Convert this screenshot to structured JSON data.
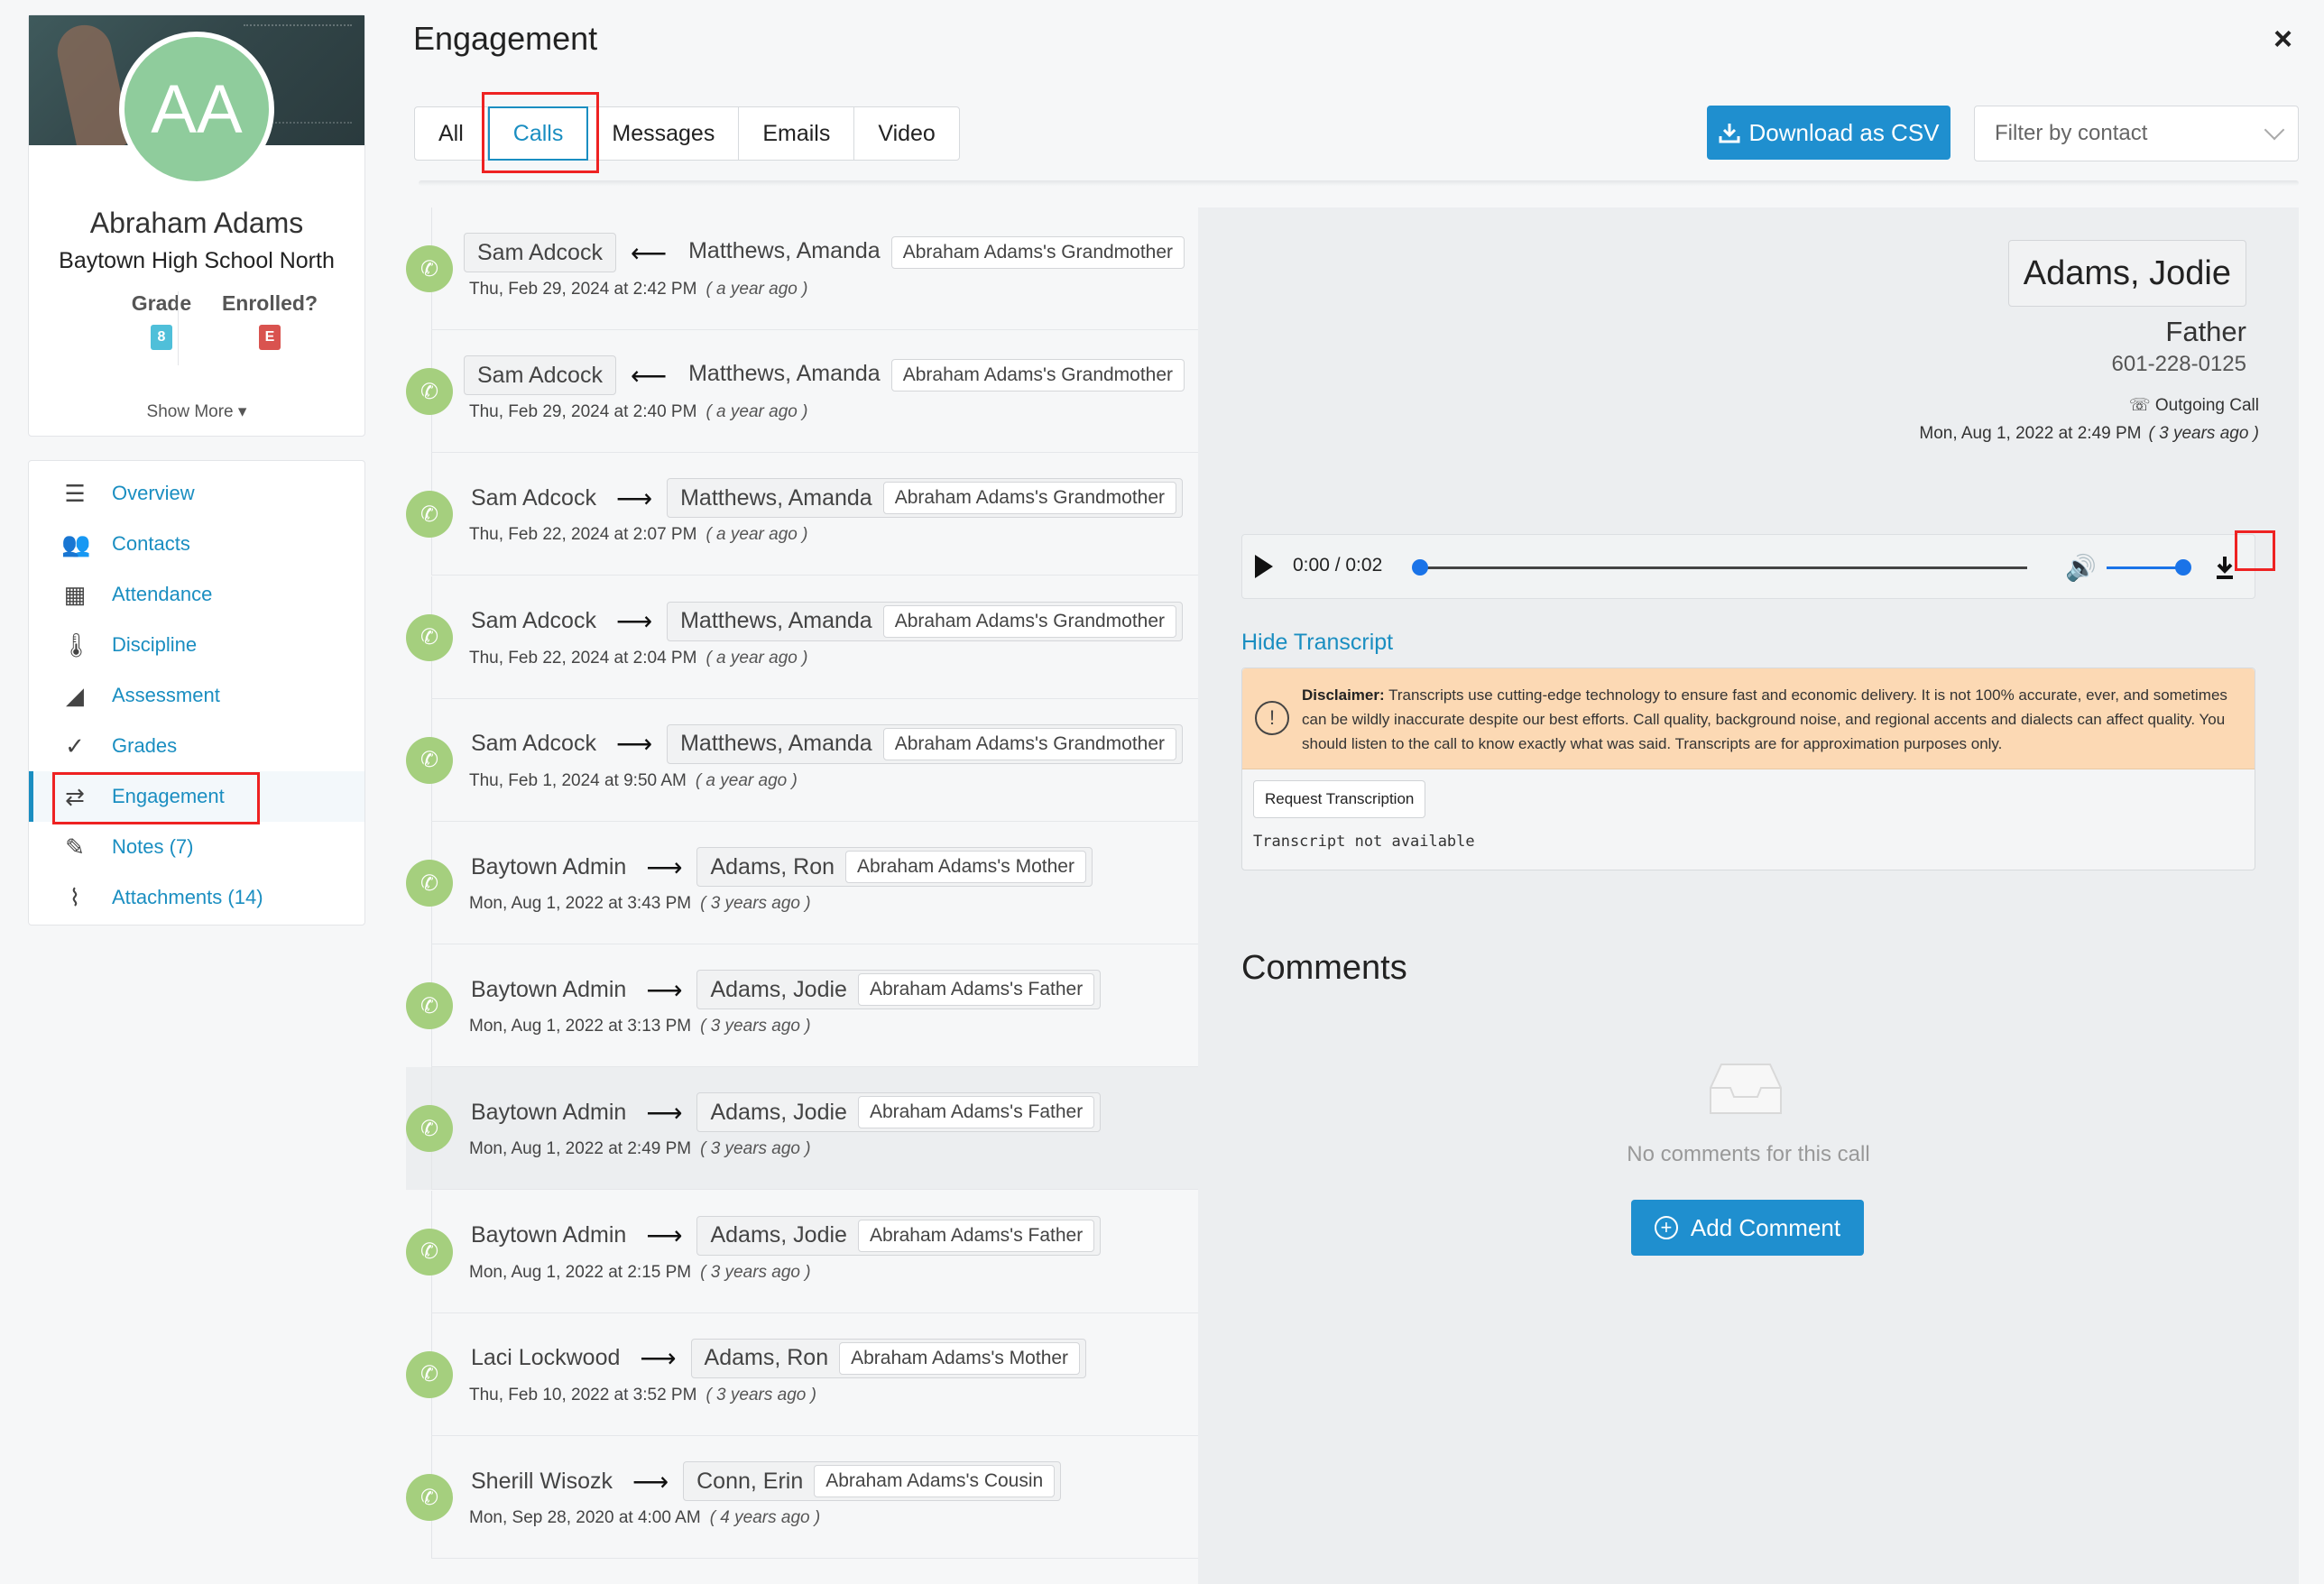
{
  "profile": {
    "initials": "AA",
    "name": "Abraham Adams",
    "school": "Baytown High School North",
    "grade_label": "Grade",
    "grade_value": "8",
    "enrolled_label": "Enrolled?",
    "enrolled_value": "E",
    "show_more": "Show More ▾"
  },
  "nav": {
    "items": [
      {
        "label": "Overview",
        "icon": "list-icon"
      },
      {
        "label": "Contacts",
        "icon": "contacts-icon"
      },
      {
        "label": "Attendance",
        "icon": "calendar-icon"
      },
      {
        "label": "Discipline",
        "icon": "thermometer-icon"
      },
      {
        "label": "Assessment",
        "icon": "chart-icon"
      },
      {
        "label": "Grades",
        "icon": "check-icon"
      },
      {
        "label": "Engagement",
        "icon": "exchange-icon",
        "active": true
      },
      {
        "label": "Notes (7)",
        "icon": "pencil-icon"
      },
      {
        "label": "Attachments (14)",
        "icon": "paperclip-icon"
      }
    ]
  },
  "header": {
    "title": "Engagement",
    "close": "×",
    "tabs": [
      "All",
      "Calls",
      "Messages",
      "Emails",
      "Video"
    ],
    "selected_tab": "Calls",
    "csv_button": "Download as CSV",
    "filter_placeholder": "Filter by contact"
  },
  "calls": [
    {
      "from": "Sam Adcock",
      "dir": "⟵",
      "to": "Matthews, Amanda",
      "relation": "Abraham Adams's Grandmother",
      "from_chip": true,
      "date": "Thu, Feb 29, 2024 at 2:42 PM",
      "ago": "( a year ago )"
    },
    {
      "from": "Sam Adcock",
      "dir": "⟵",
      "to": "Matthews, Amanda",
      "relation": "Abraham Adams's Grandmother",
      "from_chip": true,
      "date": "Thu, Feb 29, 2024 at 2:40 PM",
      "ago": "( a year ago )"
    },
    {
      "from": "Sam Adcock",
      "dir": "⟶",
      "to": "Matthews, Amanda",
      "relation": "Abraham Adams's Grandmother",
      "from_chip": false,
      "date": "Thu, Feb 22, 2024 at 2:07 PM",
      "ago": "( a year ago )"
    },
    {
      "from": "Sam Adcock",
      "dir": "⟶",
      "to": "Matthews, Amanda",
      "relation": "Abraham Adams's Grandmother",
      "from_chip": false,
      "date": "Thu, Feb 22, 2024 at 2:04 PM",
      "ago": "( a year ago )"
    },
    {
      "from": "Sam Adcock",
      "dir": "⟶",
      "to": "Matthews, Amanda",
      "relation": "Abraham Adams's Grandmother",
      "from_chip": false,
      "date": "Thu, Feb 1, 2024 at 9:50 AM",
      "ago": "( a year ago )"
    },
    {
      "from": "Baytown Admin",
      "dir": "⟶",
      "to": "Adams, Ron",
      "relation": "Abraham Adams's Mother",
      "from_chip": false,
      "date": "Mon, Aug 1, 2022 at 3:43 PM",
      "ago": "( 3 years ago )"
    },
    {
      "from": "Baytown Admin",
      "dir": "⟶",
      "to": "Adams, Jodie",
      "relation": "Abraham Adams's Father",
      "from_chip": false,
      "date": "Mon, Aug 1, 2022 at 3:13 PM",
      "ago": "( 3 years ago )"
    },
    {
      "from": "Baytown Admin",
      "dir": "⟶",
      "to": "Adams, Jodie",
      "relation": "Abraham Adams's Father",
      "from_chip": false,
      "date": "Mon, Aug 1, 2022 at 2:49 PM",
      "ago": "( 3 years ago )",
      "selected": true
    },
    {
      "from": "Baytown Admin",
      "dir": "⟶",
      "to": "Adams, Jodie",
      "relation": "Abraham Adams's Father",
      "from_chip": false,
      "date": "Mon, Aug 1, 2022 at 2:15 PM",
      "ago": "( 3 years ago )"
    },
    {
      "from": "Laci Lockwood",
      "dir": "⟶",
      "to": "Adams, Ron",
      "relation": "Abraham Adams's Mother",
      "from_chip": false,
      "date": "Thu, Feb 10, 2022 at 3:52 PM",
      "ago": "( 3 years ago )"
    },
    {
      "from": "Sherill Wisozk",
      "dir": "⟶",
      "to": "Conn, Erin",
      "relation": "Abraham Adams's Cousin",
      "from_chip": false,
      "date": "Mon, Sep 28, 2020 at 4:00 AM",
      "ago": "( 4 years ago )"
    }
  ],
  "detail": {
    "contact_name": "Adams, Jodie",
    "role": "Father",
    "phone": "601-228-0125",
    "call_type": "Outgoing Call",
    "call_time": "Mon, Aug 1, 2022 at 2:49 PM",
    "call_ago": "( 3 years ago )",
    "player_time": "0:00 / 0:02",
    "playback_progress": 0.0,
    "volume": 1.0,
    "hide_transcript": "Hide Transcript",
    "disclaimer_label": "Disclaimer:",
    "disclaimer_text": "Transcripts use cutting-edge technology to ensure fast and economic delivery. It is not 100% accurate, ever, and sometimes can be wildly inaccurate despite our best efforts. Call quality, background noise, and regional accents and dialects can affect quality. You should listen to the call to know exactly what was said. Transcripts are for approximation purposes only.",
    "request_button": "Request Transcription",
    "transcript_status": "Transcript not available",
    "comments_title": "Comments",
    "no_comments": "No comments for this call",
    "add_comment": "Add Comment"
  },
  "colors": {
    "accent": "#1a8ec1",
    "button": "#1f8fcf",
    "phone_icon": "#a5cf7e",
    "avatar": "#8fcc9c",
    "highlight_box": "#e22222",
    "disclaimer_bg": "#fcd9b4"
  }
}
